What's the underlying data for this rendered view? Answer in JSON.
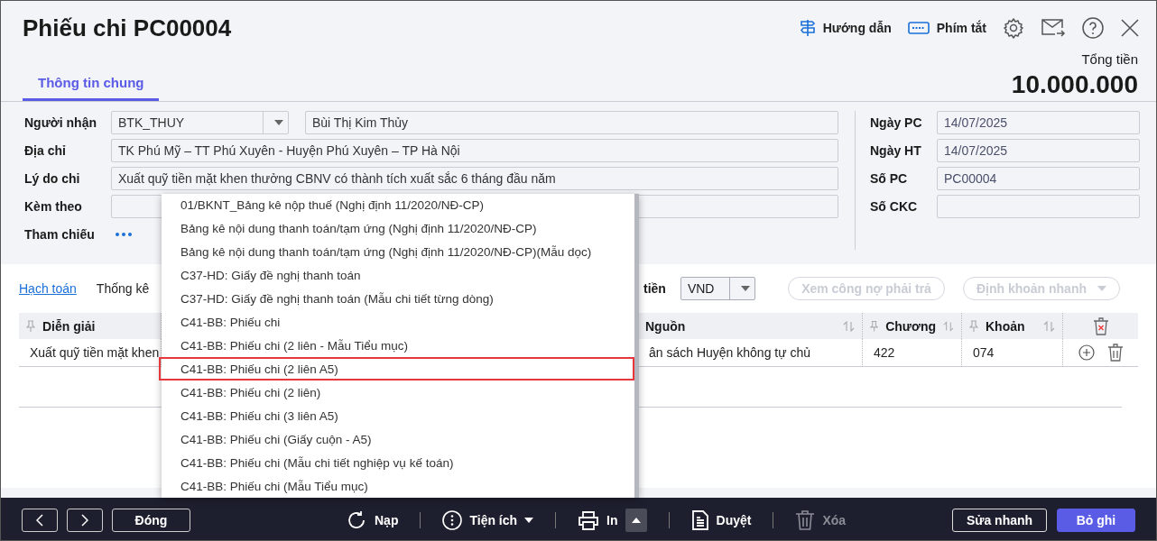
{
  "header": {
    "title": "Phiếu chi PC00004",
    "tools": [
      {
        "kind": "guide",
        "label": "Hướng dẫn"
      },
      {
        "kind": "keyboard",
        "label": "Phím tắt"
      },
      {
        "kind": "settings"
      },
      {
        "kind": "mail"
      },
      {
        "kind": "help"
      },
      {
        "kind": "close"
      }
    ],
    "total_label": "Tổng tiền",
    "total_value": "10.000.000"
  },
  "tabs": [
    {
      "label": "Thông tin chung",
      "selected": true
    }
  ],
  "form": {
    "left": [
      {
        "label": "Người nhận",
        "kind": "combo",
        "value": "BTK_THUY",
        "extra": "Bùi Thị Kim Thủy"
      },
      {
        "label": "Địa chỉ",
        "kind": "text",
        "value": "TK Phú Mỹ –  TT Phú Xuyên  -  Huyện Phú Xuyên – TP Hà Nội"
      },
      {
        "label": "Lý do chi",
        "kind": "text",
        "value": "Xuất quỹ tiền mặt khen thưởng CBNV có thành tích xuất sắc 6 tháng đầu năm"
      },
      {
        "label": "Kèm theo",
        "kind": "text"
      },
      {
        "label": "Tham chiếu",
        "kind": "dots"
      }
    ],
    "right": [
      {
        "label": "Ngày PC",
        "value": "14/07/2025"
      },
      {
        "label": "Ngày HT",
        "value": "14/07/2025"
      },
      {
        "label": "Số PC",
        "value": "PC00004"
      },
      {
        "label": "Số CKC"
      }
    ]
  },
  "detail": {
    "tabs": [
      {
        "label": "Hạch toán",
        "selected": true
      },
      {
        "label": "Thống kê",
        "selected": false
      }
    ],
    "currency_label": "tiền",
    "currency": "VND",
    "buttons": [
      {
        "label": "Xem công nợ phải trả",
        "disabled": true,
        "dropdown": false
      },
      {
        "label": "Định khoản nhanh",
        "disabled": true,
        "dropdown": true
      }
    ],
    "columns": [
      {
        "label": "Diễn giải",
        "pinned": true,
        "sortable": false
      },
      {
        "label": "Nguồn",
        "pinned": false,
        "sortable": true
      },
      {
        "label": "Chương",
        "pinned": true,
        "sortable": true
      },
      {
        "label": "Khoản",
        "pinned": true,
        "sortable": true
      }
    ],
    "rows": [
      {
        "cells": [
          "Xuất quỹ tiền mặt khen",
          "ân sách Huyện không tự chủ",
          "422",
          "074"
        ]
      }
    ]
  },
  "print_menu": {
    "items": [
      {
        "label": "01/BKNT_Bảng kê nộp thuế (Nghị định 11/2020/NĐ-CP)",
        "selected": false
      },
      {
        "label": "Bảng kê nội dung thanh toán/tạm ứng (Nghị định 11/2020/NĐ-CP)",
        "selected": false
      },
      {
        "label": "Bảng kê nội dung thanh toán/tạm ứng (Nghị định 11/2020/NĐ-CP)(Mẫu dọc)",
        "selected": false
      },
      {
        "label": "C37-HD: Giấy đề nghị thanh toán",
        "selected": false
      },
      {
        "label": "C37-HD: Giấy đề nghị thanh toán (Mẫu chi tiết từng dòng)",
        "selected": false
      },
      {
        "label": "C41-BB: Phiếu chi",
        "selected": false
      },
      {
        "label": "C41-BB: Phiếu chi (2 liên - Mẫu Tiểu mục)",
        "selected": false
      },
      {
        "label": "C41-BB: Phiếu chi (2 liên A5)",
        "selected": true
      },
      {
        "label": "C41-BB: Phiếu chi (2 liên)",
        "selected": false
      },
      {
        "label": "C41-BB: Phiếu chi (3 liên A5)",
        "selected": false
      },
      {
        "label": "C41-BB: Phiếu chi (Giấy cuộn - A5)",
        "selected": false
      },
      {
        "label": "C41-BB: Phiếu chi (Mẫu chi tiết nghiệp vụ kế toán)",
        "selected": false
      },
      {
        "label": "C41-BB: Phiếu chi (Mẫu Tiểu mục)",
        "selected": false
      }
    ]
  },
  "footer": {
    "nav": [
      {
        "kind": "prev"
      },
      {
        "kind": "next"
      },
      {
        "kind": "text",
        "label": "Đóng"
      }
    ],
    "actions": [
      {
        "kind": "reload",
        "label": "Nạp",
        "disabled": false
      },
      {
        "kind": "utilities",
        "label": "Tiện ích",
        "disabled": false
      },
      {
        "kind": "print",
        "label": "In",
        "disabled": false
      },
      {
        "kind": "approve",
        "label": "Duyệt",
        "disabled": false
      },
      {
        "kind": "delete",
        "label": "Xóa",
        "disabled": true
      }
    ],
    "buttons": [
      {
        "label": "Sửa nhanh",
        "primary": false
      },
      {
        "label": "Bỏ ghi",
        "primary": true
      }
    ]
  }
}
